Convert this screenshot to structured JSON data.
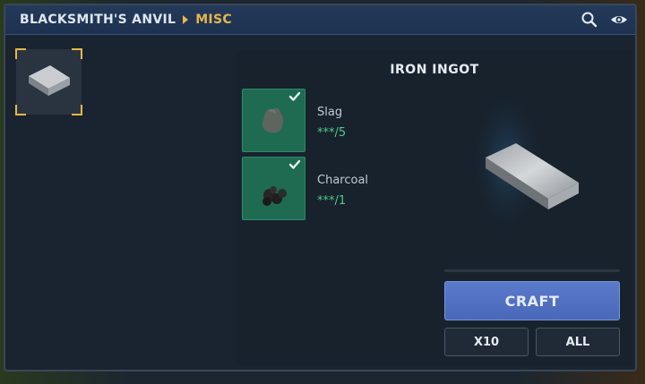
{
  "breadcrumb": {
    "root": "BLACKSMITH'S ANVIL",
    "current": "MISC"
  },
  "toolbar": {
    "icons": [
      "search-icon",
      "eye-icon"
    ]
  },
  "selected_item": {
    "icon": "iron-ingot-icon"
  },
  "detail": {
    "title": "IRON INGOT",
    "ingredients": [
      {
        "name": "Slag",
        "qty": "***/5",
        "icon": "slag-icon",
        "satisfied": true
      },
      {
        "name": "Charcoal",
        "qty": "***/1",
        "icon": "charcoal-icon",
        "satisfied": true
      }
    ],
    "preview_icon": "iron-ingot-icon"
  },
  "actions": {
    "craft": "CRAFT",
    "x10": "X10",
    "all": "ALL"
  },
  "colors": {
    "accent": "#e8b64a",
    "ingredient_bg": "#1f6b52",
    "check": "#4ecb86",
    "craft_button": "#5470c0"
  }
}
